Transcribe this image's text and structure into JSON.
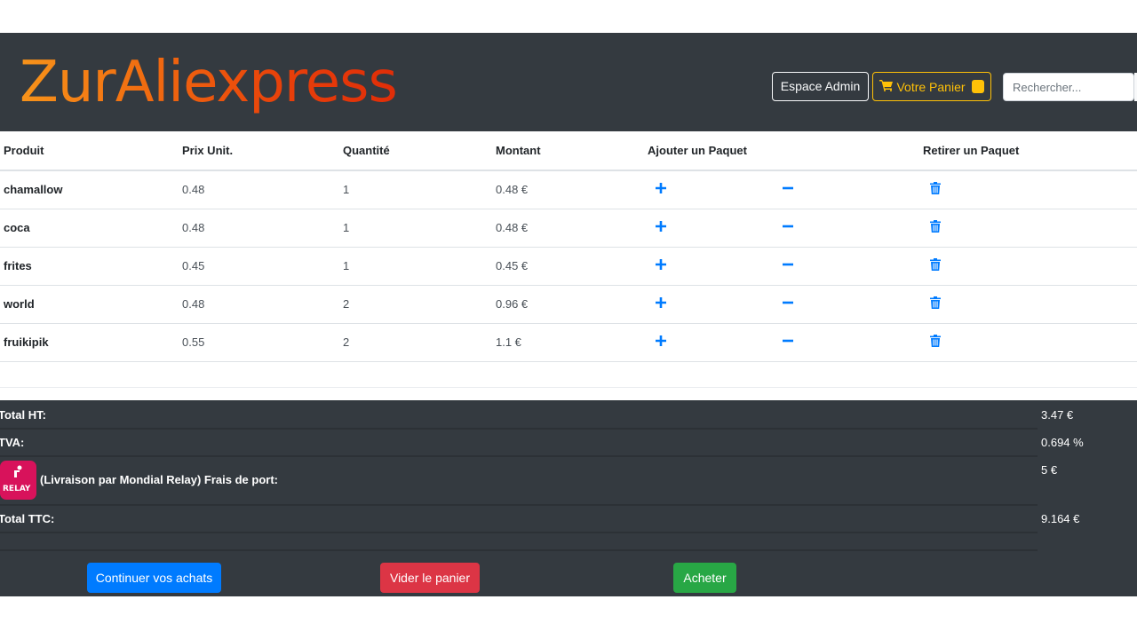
{
  "header": {
    "brand": "ZurAliexpress",
    "admin_label": "Espace Admin",
    "cart_label": "Votre Panier",
    "search_placeholder": "Rechercher..."
  },
  "table": {
    "columns": [
      "Produit",
      "Prix Unit.",
      "Quantité",
      "Montant",
      "Ajouter un Paquet",
      "Retirer un Paquet"
    ],
    "rows": [
      {
        "product": "chamallow",
        "price": "0.48",
        "qty": "1",
        "amount": "0.48 €"
      },
      {
        "product": "coca",
        "price": "0.48",
        "qty": "1",
        "amount": "0.48 €"
      },
      {
        "product": "frites",
        "price": "0.45",
        "qty": "1",
        "amount": "0.45 €"
      },
      {
        "product": "world",
        "price": "0.48",
        "qty": "2",
        "amount": "0.96 €"
      },
      {
        "product": "fruikipik",
        "price": "0.55",
        "qty": "2",
        "amount": "1.1 €"
      }
    ]
  },
  "summary": {
    "total_ht_label": "Total HT:",
    "total_ht_value": "3.47 €",
    "tva_label": "TVA:",
    "tva_value": "0.694 %",
    "shipping_label": "(Livraison par Mondial Relay) Frais de port:",
    "shipping_value": "5 €",
    "total_ttc_label": "Total TTC:",
    "total_ttc_value": "9.164 €",
    "relay_logo_text": "RELAY"
  },
  "actions": {
    "continue_label": "Continuer vos achats",
    "empty_label": "Vider le panier",
    "buy_label": "Acheter"
  },
  "colors": {
    "navbar": "#343a40",
    "primary": "#007bff",
    "danger": "#dc3545",
    "success": "#28a745",
    "warning": "#ffc107",
    "relay": "#d8125b"
  },
  "icons": {
    "add": "plus-icon",
    "remove": "minus-icon",
    "delete": "trash-icon",
    "cart": "cart-icon"
  }
}
